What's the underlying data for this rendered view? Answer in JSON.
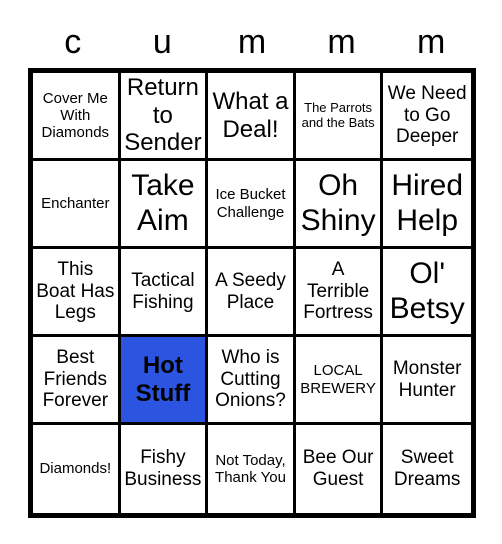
{
  "card": {
    "header_letters": [
      "c",
      "u",
      "m",
      "m",
      "m"
    ],
    "marked_color": "#2b55e0",
    "grid_color": "#000000",
    "background_color": "#ffffff",
    "rows": [
      [
        {
          "text": "Cover Me With Diamonds",
          "size": "s",
          "marked": false
        },
        {
          "text": "Return to Sender",
          "size": "l",
          "marked": false
        },
        {
          "text": "What a Deal!",
          "size": "l",
          "marked": false
        },
        {
          "text": "The Parrots and the Bats",
          "size": "xs",
          "marked": false
        },
        {
          "text": "We Need to Go Deeper",
          "size": "m",
          "marked": false
        }
      ],
      [
        {
          "text": "Enchanter",
          "size": "s",
          "marked": false
        },
        {
          "text": "Take Aim",
          "size": "xl",
          "marked": false
        },
        {
          "text": "Ice Bucket Challenge",
          "size": "s",
          "marked": false
        },
        {
          "text": "Oh Shiny",
          "size": "xl",
          "marked": false
        },
        {
          "text": "Hired Help",
          "size": "xl",
          "marked": false
        }
      ],
      [
        {
          "text": "This Boat Has Legs",
          "size": "m",
          "marked": false
        },
        {
          "text": "Tactical Fishing",
          "size": "m",
          "marked": false
        },
        {
          "text": "A Seedy Place",
          "size": "m",
          "marked": false
        },
        {
          "text": "A Terrible Fortress",
          "size": "m",
          "marked": false
        },
        {
          "text": "Ol' Betsy",
          "size": "xl",
          "marked": false
        }
      ],
      [
        {
          "text": "Best Friends Forever",
          "size": "m",
          "marked": false
        },
        {
          "text": "Hot Stuff",
          "size": "l",
          "marked": true
        },
        {
          "text": "Who is Cutting Onions?",
          "size": "m",
          "marked": false
        },
        {
          "text": "LOCAL BREWERY",
          "size": "s",
          "marked": false
        },
        {
          "text": "Monster Hunter",
          "size": "m",
          "marked": false
        }
      ],
      [
        {
          "text": "Diamonds!",
          "size": "s",
          "marked": false
        },
        {
          "text": "Fishy Business",
          "size": "m",
          "marked": false
        },
        {
          "text": "Not Today, Thank You",
          "size": "s",
          "marked": false
        },
        {
          "text": "Bee Our Guest",
          "size": "m",
          "marked": false
        },
        {
          "text": "Sweet Dreams",
          "size": "m",
          "marked": false
        }
      ]
    ]
  }
}
